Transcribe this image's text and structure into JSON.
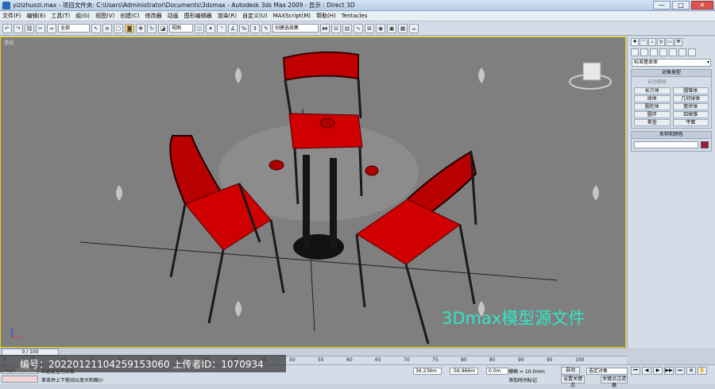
{
  "titlebar": {
    "text": "yizizhuozi.max     - 项目文件夹: C:\\Users\\Administrator\\Documents\\3dsmax     - Autodesk 3ds Max  2009     - 显示 : Direct 3D",
    "minimize": "—",
    "maximize": "□",
    "close": "✕"
  },
  "menu": [
    "文件(F)",
    "编辑(E)",
    "工具(T)",
    "组(G)",
    "视图(V)",
    "创建(C)",
    "修改器",
    "动画",
    "图形编辑器",
    "渲染(R)",
    "自定义(U)",
    "MAXScript(M)",
    "帮助(H)",
    "Tentacles"
  ],
  "toolbar": {
    "selection_filter": "全部",
    "ref_coord": "视图",
    "named_selection": "创建选择集"
  },
  "viewport": {
    "label": "透视",
    "brand_text": "3Dmax模型源文件"
  },
  "command_panel": {
    "category_dropdown": "标准基本体",
    "object_type_header": "对象类型",
    "autogrid_label": "自动栅格",
    "objects": [
      "长方体",
      "圆锥体",
      "球体",
      "几何球体",
      "圆柱体",
      "管状体",
      "圆环",
      "四棱锥",
      "茶壶",
      "平面"
    ],
    "name_color_header": "名称和颜色",
    "color": "#a0183a"
  },
  "time_slider": {
    "frame_display": "0 / 100",
    "ticks": [
      "0",
      "5",
      "10",
      "15",
      "20",
      "25",
      "30",
      "35",
      "40",
      "45",
      "50",
      "55",
      "60",
      "65",
      "70",
      "75",
      "80",
      "85",
      "90",
      "95",
      "100"
    ]
  },
  "status": {
    "script_label": "rxipt:",
    "line1": "未选定任何对象",
    "line2": "单击并上下拖动以放大和缩小",
    "x_value": "36.239m",
    "y_value": "-56.966m",
    "z_value": "0.0m",
    "grid_label": "栅格 = 10.0mm",
    "autokey_label": "自动",
    "setkey_label": "设置关键点",
    "selected_label": "选定对象",
    "keyfilter_label": "关键点过滤器",
    "addtimetag_label": "添加时间标记"
  },
  "watermark": {
    "text": "编号：20220121104259153060 上传者ID：1070934"
  }
}
